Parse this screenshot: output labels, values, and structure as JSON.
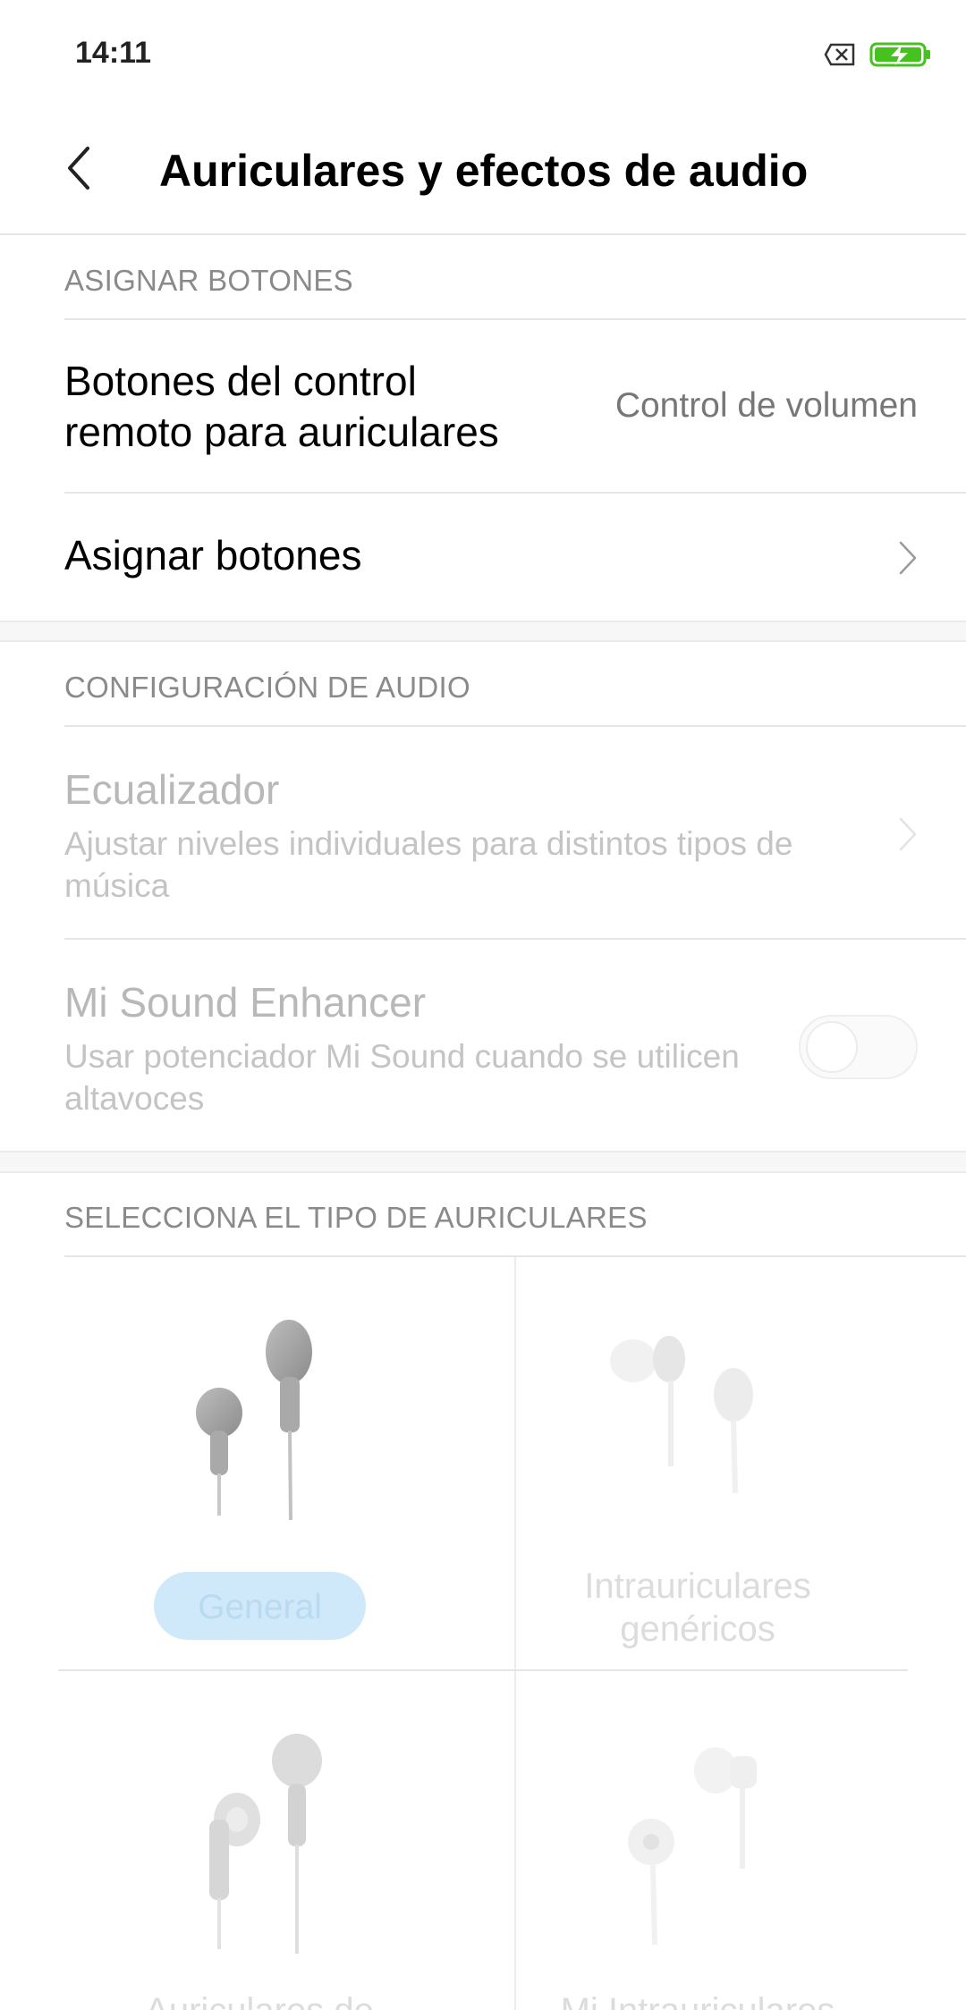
{
  "status_bar": {
    "time": "14:11",
    "icons": [
      "sim-off-icon",
      "battery-charging-icon"
    ],
    "battery_color": "#45c21e"
  },
  "header": {
    "title": "Auriculares y efectos de audio",
    "back_icon": "chevron-left-icon"
  },
  "sections": {
    "assign": {
      "header": "ASIGNAR BOTONES",
      "remote_title": "Botones del control remoto para auriculares",
      "remote_value": "Control de volumen",
      "assign_title": "Asignar botones"
    },
    "audio": {
      "header": "CONFIGURACIÓN DE AUDIO",
      "equalizer_title": "Ecualizador",
      "equalizer_sub": "Ajustar niveles individuales para distintos tipos de música",
      "enhancer_title": "Mi Sound Enhancer",
      "enhancer_sub": "Usar potenciador Mi Sound cuando se utilicen altavoces",
      "enhancer_on": false
    },
    "headphones": {
      "header": "SELECCIONA EL TIPO DE AURICULARES",
      "types": [
        {
          "label": "General",
          "selected": true
        },
        {
          "label": "Intrauriculares genéricos",
          "selected": false
        },
        {
          "label": "Auriculares de",
          "selected": false
        },
        {
          "label": "Mi Intrauriculares",
          "selected": false
        }
      ]
    }
  }
}
